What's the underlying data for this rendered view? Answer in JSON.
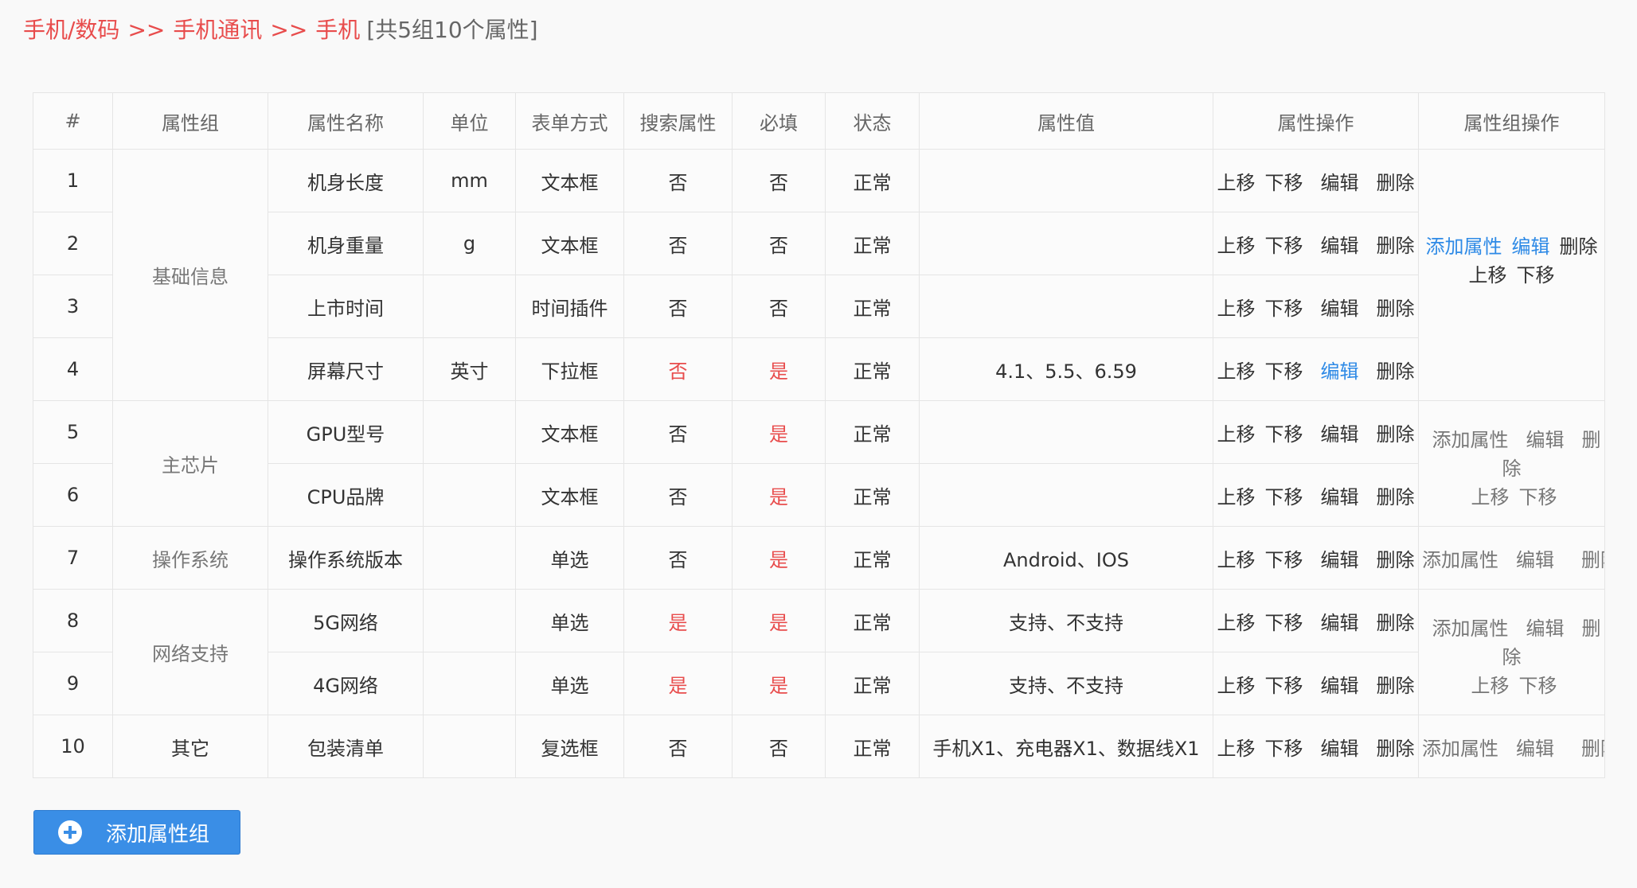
{
  "breadcrumb": {
    "items": [
      "手机/数码",
      "手机通讯",
      "手机"
    ],
    "separator": ">>",
    "count": "[共5组10个属性]"
  },
  "table": {
    "headers": [
      "#",
      "属性组",
      "属性名称",
      "单位",
      "表单方式",
      "搜索属性",
      "必填",
      "状态",
      "属性值",
      "属性操作",
      "属性组操作"
    ],
    "groups": [
      "基础信息",
      "主芯片",
      "操作系统",
      "网络支持",
      "其它"
    ],
    "rows": [
      {
        "no": "1",
        "name": "机身长度",
        "unit": "mm",
        "form": "文本框",
        "search": "否",
        "required": "否",
        "status": "正常",
        "values": ""
      },
      {
        "no": "2",
        "name": "机身重量",
        "unit": "g",
        "form": "文本框",
        "search": "否",
        "required": "否",
        "status": "正常",
        "values": ""
      },
      {
        "no": "3",
        "name": "上市时间",
        "unit": "",
        "form": "时间插件",
        "search": "否",
        "required": "否",
        "status": "正常",
        "values": ""
      },
      {
        "no": "4",
        "name": "屏幕尺寸",
        "unit": "英寸",
        "form": "下拉框",
        "search": "否",
        "required": "是",
        "status": "正常",
        "values": "4.1、5.5、6.59"
      },
      {
        "no": "5",
        "name": "GPU型号",
        "unit": "",
        "form": "文本框",
        "search": "否",
        "required": "是",
        "status": "正常",
        "values": ""
      },
      {
        "no": "6",
        "name": "CPU品牌",
        "unit": "",
        "form": "文本框",
        "search": "否",
        "required": "是",
        "status": "正常",
        "values": ""
      },
      {
        "no": "7",
        "name": "操作系统版本",
        "unit": "",
        "form": "单选",
        "search": "否",
        "required": "是",
        "status": "正常",
        "values": "Android、IOS"
      },
      {
        "no": "8",
        "name": "5G网络",
        "unit": "",
        "form": "单选",
        "search": "是",
        "required": "是",
        "status": "正常",
        "values": "支持、不支持"
      },
      {
        "no": "9",
        "name": "4G网络",
        "unit": "",
        "form": "单选",
        "search": "是",
        "required": "是",
        "status": "正常",
        "values": "支持、不支持"
      },
      {
        "no": "10",
        "name": "包装清单",
        "unit": "",
        "form": "复选框",
        "search": "否",
        "required": "否",
        "status": "正常",
        "values": "手机X1、充电器X1、数据线X1"
      }
    ],
    "attr_ops": {
      "up": "上移",
      "down": "下移",
      "edit": "编辑",
      "delete": "删除"
    },
    "group_ops": {
      "add": "添加属性",
      "edit": "编辑",
      "delete": "删除",
      "del_part1": "删",
      "del_part2": "除",
      "up": "上移",
      "down": "下移"
    }
  },
  "add_group_button": "添加属性组",
  "colors": {
    "accent": "#e84c4c",
    "link": "#2e8ae6",
    "button": "#3a8ee6"
  }
}
